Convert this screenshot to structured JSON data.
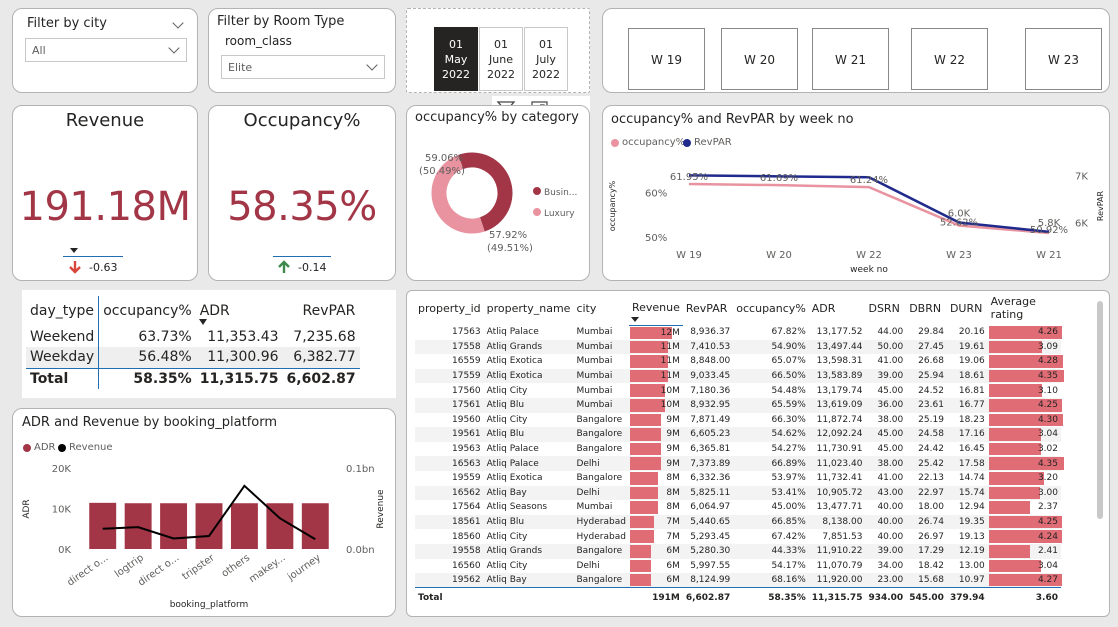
{
  "filters": {
    "city": {
      "title": "Filter by city",
      "value": "All"
    },
    "room_type": {
      "title": "Filter by Room Type",
      "subtitle": "room_class",
      "value": "Elite"
    }
  },
  "months": [
    {
      "day": "01",
      "month": "May",
      "year": "2022",
      "selected": true
    },
    {
      "day": "01",
      "month": "June",
      "year": "2022",
      "selected": false
    },
    {
      "day": "01",
      "month": "July",
      "year": "2022",
      "selected": false
    }
  ],
  "weeks": [
    "W 19",
    "W 20",
    "W 21",
    "W 22",
    "W 23"
  ],
  "visual_toolbar": {
    "filter_icon": "filter-icon",
    "focus_icon": "focus-mode-icon",
    "more_icon": "more-options-icon"
  },
  "kpis": {
    "revenue": {
      "title": "Revenue",
      "value": "191.18M",
      "delta": "-0.63"
    },
    "occupancy": {
      "title": "Occupancy%",
      "value": "58.35%",
      "delta": "-0.14"
    }
  },
  "colors": {
    "accent": "#a23646",
    "pink": "#e8939f",
    "navy": "#1f2a8c",
    "bar": "#e06c75",
    "down": "#d9453a",
    "up": "#3d8a4a"
  },
  "donut": {
    "title": "occupancy% by category",
    "slices": [
      {
        "name": "Busin...",
        "value": 59.06,
        "share": 50.49,
        "label": "59.06%",
        "sublabel": "(50.49%)",
        "color": "#a23646"
      },
      {
        "name": "Luxury",
        "value": 57.92,
        "share": 49.51,
        "label": "57.92%",
        "sublabel": "(49.51%)",
        "color": "#e8939f"
      }
    ]
  },
  "line_chart": {
    "title": "occupancy% and RevPAR by week no",
    "legend": [
      "occupancy%",
      "RevPAR"
    ],
    "xlabel": "week no",
    "ylabel_left": "occupancy%",
    "ylabel_right": "RevPAR",
    "yticks_left": [
      "60%",
      "50%"
    ],
    "yticks_right": [
      "7K",
      "6K"
    ]
  },
  "day_type_table": {
    "headers": [
      "day_type",
      "occupancy%",
      "ADR",
      "RevPAR"
    ],
    "rows": [
      [
        "Weekend",
        "63.73%",
        "11,353.43",
        "7,235.68"
      ],
      [
        "Weekday",
        "56.48%",
        "11,300.96",
        "6,382.77"
      ]
    ],
    "total": [
      "Total",
      "58.35%",
      "11,315.75",
      "6,602.87"
    ]
  },
  "combo_chart": {
    "title": "ADR and Revenue by booking_platform",
    "legend": [
      "ADR",
      "Revenue"
    ],
    "xlabel": "booking_platform",
    "ylabel_left": "ADR",
    "ylabel_right": "Revenue",
    "yticks_left": [
      "20K",
      "10K",
      "0K"
    ],
    "yticks_right": [
      "0.1bn",
      "0.0bn"
    ]
  },
  "property_table": {
    "headers": [
      "property_id",
      "property_name",
      "city",
      "Revenue",
      "RevPAR",
      "occupancy%",
      "ADR",
      "DSRN",
      "DBRN",
      "DURN",
      "Average rating"
    ],
    "rows": [
      [
        "17563",
        "Atliq Palace",
        "Mumbai",
        "12M",
        "8,936.37",
        "67.82%",
        "13,177.52",
        "44.00",
        "29.84",
        "20.16",
        "4.26"
      ],
      [
        "17558",
        "Atliq Grands",
        "Mumbai",
        "11M",
        "7,410.53",
        "54.90%",
        "13,497.44",
        "50.00",
        "27.45",
        "19.61",
        "3.09"
      ],
      [
        "16559",
        "Atliq Exotica",
        "Mumbai",
        "11M",
        "8,848.00",
        "65.07%",
        "13,598.31",
        "41.00",
        "26.68",
        "19.06",
        "4.28"
      ],
      [
        "17559",
        "Atliq Exotica",
        "Mumbai",
        "11M",
        "9,033.45",
        "66.50%",
        "13,583.89",
        "39.00",
        "25.94",
        "18.61",
        "4.35"
      ],
      [
        "17560",
        "Atliq City",
        "Mumbai",
        "10M",
        "7,180.36",
        "54.48%",
        "13,179.74",
        "45.00",
        "24.52",
        "16.81",
        "3.10"
      ],
      [
        "17561",
        "Atliq Blu",
        "Mumbai",
        "10M",
        "8,932.95",
        "65.59%",
        "13,619.09",
        "36.00",
        "23.61",
        "16.77",
        "4.25"
      ],
      [
        "19560",
        "Atliq City",
        "Bangalore",
        "9M",
        "7,871.49",
        "66.30%",
        "11,872.74",
        "38.00",
        "25.19",
        "18.23",
        "4.30"
      ],
      [
        "19561",
        "Atliq Blu",
        "Bangalore",
        "9M",
        "6,605.23",
        "54.62%",
        "12,092.24",
        "45.00",
        "24.58",
        "17.16",
        "3.04"
      ],
      [
        "19563",
        "Atliq Palace",
        "Bangalore",
        "9M",
        "6,365.81",
        "54.27%",
        "11,730.91",
        "45.00",
        "24.42",
        "16.45",
        "3.02"
      ],
      [
        "16563",
        "Atliq Palace",
        "Delhi",
        "9M",
        "7,373.89",
        "66.89%",
        "11,023.40",
        "38.00",
        "25.42",
        "17.58",
        "4.35"
      ],
      [
        "19559",
        "Atliq Exotica",
        "Bangalore",
        "8M",
        "6,332.36",
        "53.97%",
        "11,732.41",
        "41.00",
        "22.13",
        "14.74",
        "3.20"
      ],
      [
        "16562",
        "Atliq Bay",
        "Delhi",
        "8M",
        "5,825.11",
        "53.41%",
        "10,905.72",
        "43.00",
        "22.97",
        "15.74",
        "3.00"
      ],
      [
        "17564",
        "Atliq Seasons",
        "Mumbai",
        "8M",
        "6,064.97",
        "45.00%",
        "13,477.71",
        "40.00",
        "18.00",
        "12.94",
        "2.37"
      ],
      [
        "18561",
        "Atliq Blu",
        "Hyderabad",
        "7M",
        "5,440.65",
        "66.85%",
        "8,138.00",
        "40.00",
        "26.74",
        "19.35",
        "4.25"
      ],
      [
        "18560",
        "Atliq City",
        "Hyderabad",
        "7M",
        "5,293.45",
        "67.42%",
        "7,851.53",
        "40.00",
        "26.97",
        "19.13",
        "4.24"
      ],
      [
        "19558",
        "Atliq Grands",
        "Bangalore",
        "6M",
        "5,280.30",
        "44.33%",
        "11,910.22",
        "39.00",
        "17.29",
        "12.19",
        "2.41"
      ],
      [
        "16560",
        "Atliq City",
        "Delhi",
        "6M",
        "5,997.55",
        "54.17%",
        "11,070.79",
        "34.00",
        "18.42",
        "13.00",
        "3.04"
      ],
      [
        "19562",
        "Atliq Bay",
        "Bangalore",
        "6M",
        "8,124.99",
        "68.16%",
        "11,920.00",
        "23.00",
        "15.68",
        "10.97",
        "4.27"
      ]
    ],
    "total": [
      "Total",
      "",
      "",
      "191M",
      "6,602.87",
      "58.35%",
      "11,315.75",
      "934.00",
      "545.00",
      "379.94",
      "3.60"
    ]
  },
  "chart_data": [
    {
      "type": "line",
      "title": "occupancy% and RevPAR by week no",
      "x": [
        "W 19",
        "W 20",
        "W 22",
        "W 23",
        "W 21"
      ],
      "xlabel": "week no",
      "series": [
        {
          "name": "occupancy%",
          "axis": "left",
          "values": [
            61.95,
            61.69,
            61.24,
            52.62,
            50.92
          ],
          "labels": [
            "61.95%",
            "61.69%",
            "61.24%",
            "52.62%",
            "50.92%"
          ]
        },
        {
          "name": "RevPAR",
          "axis": "right",
          "values": [
            7000,
            6980,
            6960,
            6000,
            5800
          ],
          "labels": [
            "",
            "",
            "",
            "6.0K",
            "5.8K"
          ]
        }
      ],
      "ylim_left": [
        48,
        66
      ],
      "ylim_right": [
        5500,
        7200
      ]
    },
    {
      "type": "bar",
      "title": "ADR and Revenue by booking_platform",
      "categories": [
        "direct o...",
        "logtrip",
        "direct o...",
        "tripster",
        "others",
        "makey...",
        "journey"
      ],
      "xlabel": "booking_platform",
      "series": [
        {
          "name": "ADR",
          "kind": "bar",
          "axis": "left",
          "values": [
            11400,
            11300,
            11300,
            11300,
            11300,
            11300,
            11300
          ]
        },
        {
          "name": "Revenue",
          "kind": "line",
          "axis": "right",
          "values": [
            0.025,
            0.027,
            0.013,
            0.016,
            0.078,
            0.038,
            0.012
          ]
        }
      ],
      "ylim_left": [
        0,
        20000
      ],
      "ylim_right": [
        0,
        0.1
      ]
    }
  ]
}
